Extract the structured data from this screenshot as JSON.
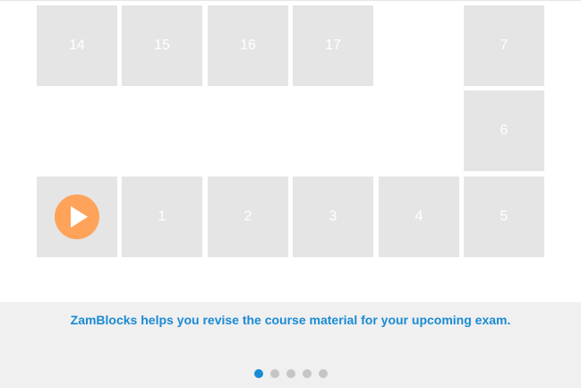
{
  "board": {
    "tiles_top": [
      "14",
      "15",
      "16",
      "17"
    ],
    "tile_7": "7",
    "tile_6": "6",
    "tiles_bottom": [
      "1",
      "2",
      "3",
      "4",
      "5"
    ],
    "start_icon": "play-icon",
    "tile_color": "#e5e5e5",
    "play_color": "#ffa35a"
  },
  "footer": {
    "tagline": "ZamBlocks helps you revise the course material for your upcoming exam.",
    "accent_color": "#1a8ad4",
    "pager": {
      "count": 5,
      "active_index": 0
    }
  }
}
